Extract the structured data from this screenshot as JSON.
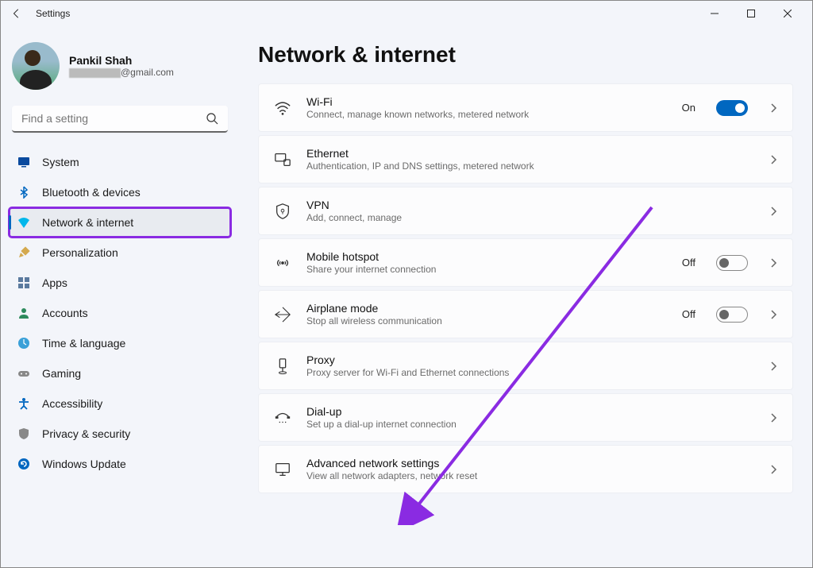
{
  "window": {
    "title": "Settings"
  },
  "profile": {
    "name": "Pankil Shah",
    "email_suffix": "@gmail.com"
  },
  "search": {
    "placeholder": "Find a setting"
  },
  "sidebar": {
    "items": [
      {
        "label": "System"
      },
      {
        "label": "Bluetooth & devices"
      },
      {
        "label": "Network & internet"
      },
      {
        "label": "Personalization"
      },
      {
        "label": "Apps"
      },
      {
        "label": "Accounts"
      },
      {
        "label": "Time & language"
      },
      {
        "label": "Gaming"
      },
      {
        "label": "Accessibility"
      },
      {
        "label": "Privacy & security"
      },
      {
        "label": "Windows Update"
      }
    ]
  },
  "page": {
    "title": "Network & internet"
  },
  "cards": {
    "wifi": {
      "title": "Wi-Fi",
      "desc": "Connect, manage known networks, metered network",
      "status": "On"
    },
    "ethernet": {
      "title": "Ethernet",
      "desc": "Authentication, IP and DNS settings, metered network"
    },
    "vpn": {
      "title": "VPN",
      "desc": "Add, connect, manage"
    },
    "hotspot": {
      "title": "Mobile hotspot",
      "desc": "Share your internet connection",
      "status": "Off"
    },
    "airplane": {
      "title": "Airplane mode",
      "desc": "Stop all wireless communication",
      "status": "Off"
    },
    "proxy": {
      "title": "Proxy",
      "desc": "Proxy server for Wi-Fi and Ethernet connections"
    },
    "dialup": {
      "title": "Dial-up",
      "desc": "Set up a dial-up internet connection"
    },
    "advanced": {
      "title": "Advanced network settings",
      "desc": "View all network adapters, network reset"
    }
  }
}
